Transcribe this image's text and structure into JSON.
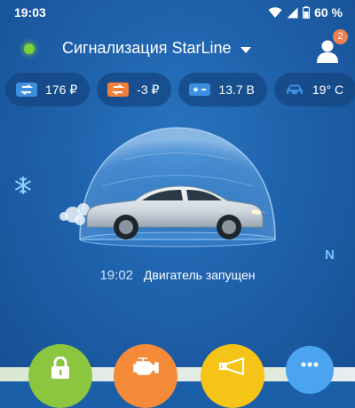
{
  "statusbar": {
    "time": "19:03",
    "battery": "60 %"
  },
  "header": {
    "title": "Сигнализация StarLine",
    "notification_count": "2"
  },
  "chips": [
    {
      "icon": "balance-icon",
      "value": "176 ₽"
    },
    {
      "icon": "balance-icon",
      "value": "-3 ₽"
    },
    {
      "icon": "car-battery-icon",
      "value": "13.7 В"
    },
    {
      "icon": "car-icon",
      "value": "19° C"
    }
  ],
  "car_status": {
    "time": "19:02",
    "text": "Двигатель запущен"
  },
  "compass_heading": "N",
  "colors": {
    "background": "#1f62ac",
    "online_indicator": "#7ad13a",
    "lock_button": "#8cc63f",
    "engine_button": "#f58a38",
    "horn_button": "#f6c416",
    "more_button": "#4aa4f0",
    "badge": "#ef7f4f"
  },
  "actions": [
    {
      "name": "lock",
      "icon": "lock-icon"
    },
    {
      "name": "engine",
      "icon": "engine-icon"
    },
    {
      "name": "horn",
      "icon": "horn-icon"
    },
    {
      "name": "more",
      "icon": "more-icon"
    }
  ]
}
